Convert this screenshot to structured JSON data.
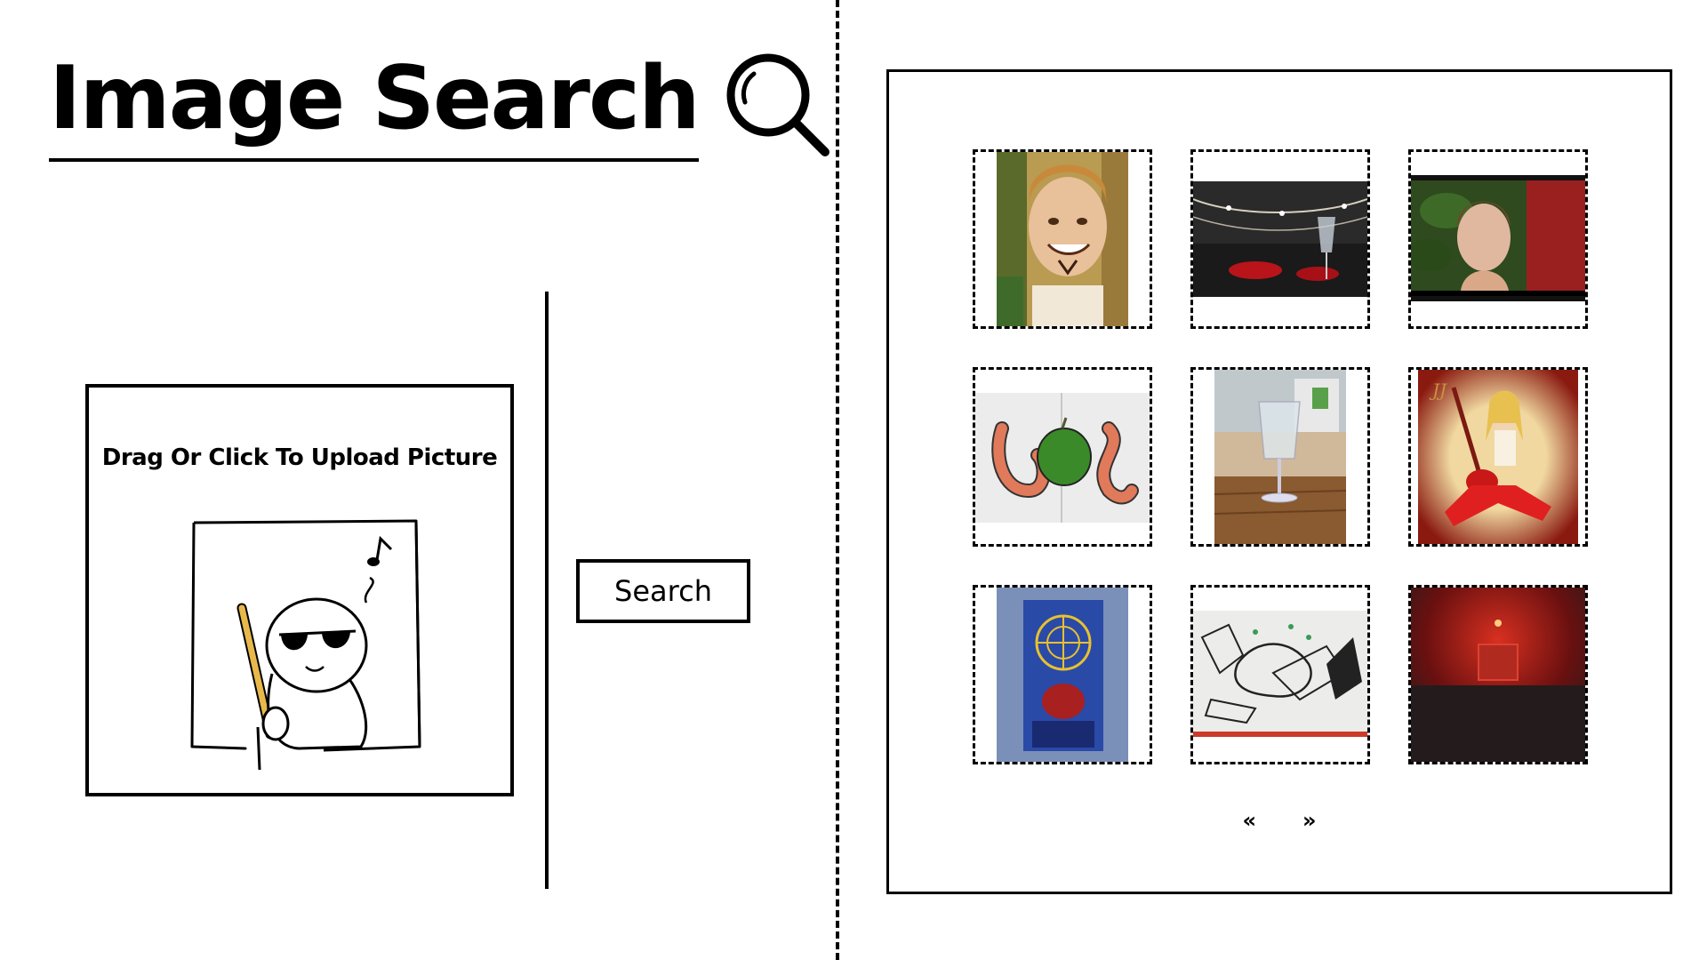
{
  "header": {
    "title": "Image Search",
    "icon": "magnifier-icon"
  },
  "upload": {
    "label": "Drag Or Click To Upload Picture",
    "illustration": "character-with-sunglasses-and-cane-icon"
  },
  "search": {
    "button_label": "Search"
  },
  "results": {
    "items": [
      {
        "name": "result-thumbnail-child-face"
      },
      {
        "name": "result-thumbnail-wine-glass-restaurant"
      },
      {
        "name": "result-thumbnail-haircut"
      },
      {
        "name": "result-thumbnail-worms-apple-drawing"
      },
      {
        "name": "result-thumbnail-water-glass-beach"
      },
      {
        "name": "result-thumbnail-guitar-girl-drawing"
      },
      {
        "name": "result-thumbnail-poster-un"
      },
      {
        "name": "result-thumbnail-graffiti-sketch"
      },
      {
        "name": "result-thumbnail-red-dark-room"
      }
    ]
  },
  "pagination": {
    "prev_label": "«",
    "next_label": "»"
  },
  "colors": {
    "border": "#000000",
    "background": "#ffffff",
    "cane": "#e8b84a"
  }
}
